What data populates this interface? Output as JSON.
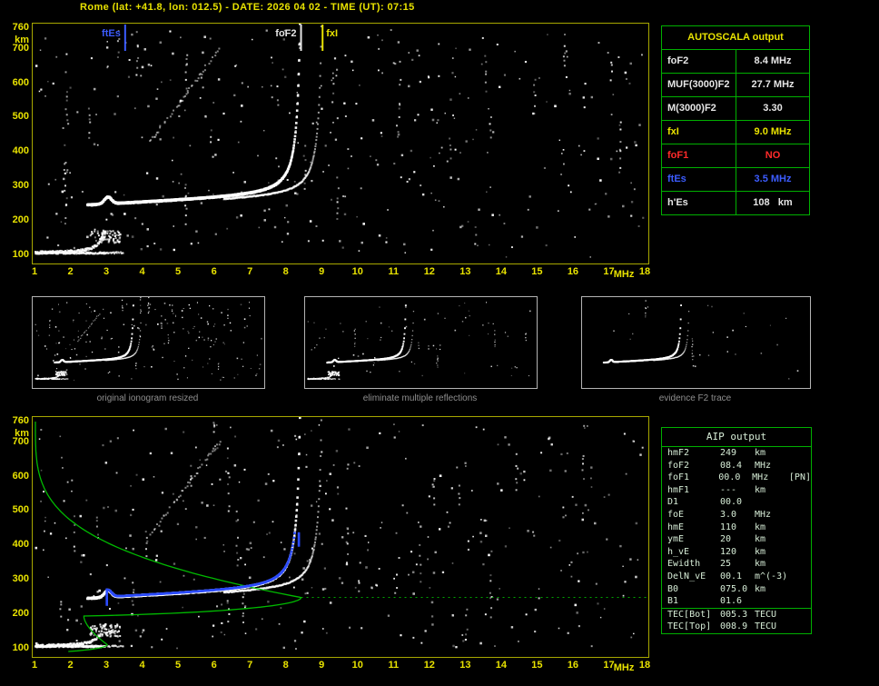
{
  "header": {
    "title": "Rome (lat: +41.8, lon: 012.5) - DATE: 2026 04 02 - TIME (UT): 07:15"
  },
  "colors": {
    "yellow": "#e8e200",
    "plot_border": "#a8a800",
    "table_green": "#00b000",
    "white": "#e6e6e6",
    "red": "#ff2a2a",
    "blue": "#3c5cff",
    "profile_green": "#00c400",
    "fit_blue": "#2b4bff",
    "caption_gray": "#8f8f8f",
    "aip_text": "#d6ecd6"
  },
  "autoscala": {
    "title": "AUTOSCALA output",
    "rows": [
      {
        "label": "foF2",
        "value": "8.4 MHz",
        "color": "#e6e6e6"
      },
      {
        "label": "MUF(3000)F2",
        "value": "27.7 MHz",
        "color": "#e6e6e6"
      },
      {
        "label": "M(3000)F2",
        "value": "3.30",
        "color": "#e6e6e6"
      },
      {
        "label": "fxI",
        "value": "9.0 MHz",
        "color": "#e8e200"
      },
      {
        "label": "foF1",
        "value": "NO",
        "color": "#ff2a2a"
      },
      {
        "label": "ftEs",
        "value": "3.5 MHz",
        "color": "#3c5cff"
      },
      {
        "label": "h'Es",
        "value": "108   km",
        "color": "#e6e6e6"
      }
    ]
  },
  "thumbnails": [
    {
      "caption": "original ionogram resized"
    },
    {
      "caption": "eliminate multiple reflections"
    },
    {
      "caption": "evidence F2 trace"
    }
  ],
  "aip": {
    "title": "AIP output",
    "rows": [
      {
        "label": "hmF2",
        "value": "249",
        "unit": "km",
        "extra": ""
      },
      {
        "label": "foF2",
        "value": "08.4",
        "unit": "MHz",
        "extra": ""
      },
      {
        "label": "foF1",
        "value": "00.0",
        "unit": "MHz",
        "extra": "[PN]"
      },
      {
        "label": "hmF1",
        "value": "---",
        "unit": "km",
        "extra": ""
      },
      {
        "label": "D1",
        "value": "00.0",
        "unit": "",
        "extra": ""
      },
      {
        "label": "foE",
        "value": "3.0",
        "unit": "MHz",
        "extra": ""
      },
      {
        "label": "hmE",
        "value": "110",
        "unit": "km",
        "extra": ""
      },
      {
        "label": "ymE",
        "value": "20",
        "unit": "km",
        "extra": ""
      },
      {
        "label": "h_vE",
        "value": "120",
        "unit": "km",
        "extra": ""
      },
      {
        "label": "Ewidth",
        "value": "25",
        "unit": "km",
        "extra": ""
      },
      {
        "label": "DelN_vE",
        "value": "00.1",
        "unit": "m^(-3)",
        "extra": ""
      },
      {
        "label": "B0",
        "value": "075.0",
        "unit": "km",
        "extra": ""
      },
      {
        "label": "B1",
        "value": "01.6",
        "unit": "",
        "extra": ""
      },
      {
        "label": "TEC[Bot]",
        "value": "005.3",
        "unit": "TECU",
        "extra": "",
        "sep": true
      },
      {
        "label": "TEC[Top]",
        "value": "008.9",
        "unit": "TECU",
        "extra": ""
      }
    ]
  },
  "chart_data": [
    {
      "type": "scatter",
      "name": "ionogram-top",
      "title": "Rome ionogram 2026-04-02 07:15 UT",
      "xlabel": "MHz",
      "ylabel": "km",
      "xlim": [
        1,
        18
      ],
      "ylim": [
        100,
        760
      ],
      "x_ticks": [
        1,
        2,
        3,
        4,
        5,
        6,
        7,
        8,
        9,
        10,
        11,
        12,
        13,
        14,
        15,
        16,
        17,
        18
      ],
      "y_ticks": [
        760,
        700,
        600,
        500,
        400,
        300,
        200,
        100
      ],
      "grid": false,
      "markers": [
        {
          "label": "ftEs",
          "freq": 3.5,
          "color": "#3c5cff"
        },
        {
          "label": "foF2",
          "freq": 8.4,
          "color": "#e6e6e6"
        },
        {
          "label": "fxI",
          "freq": 9.0,
          "color": "#e8e200"
        }
      ],
      "ionogram": {
        "foF2": 8.4,
        "fxI": 9.0,
        "foE": 3.0,
        "ftEs": 3.5,
        "hEs": 107,
        "min_virtual_height": 246,
        "second_hop": true,
        "seed": 42
      }
    },
    {
      "type": "scatter",
      "name": "ionogram-bottom-with-profile",
      "xlabel": "MHz",
      "ylabel": "km",
      "xlim": [
        1,
        18
      ],
      "ylim": [
        100,
        760
      ],
      "x_ticks": [
        1,
        2,
        3,
        4,
        5,
        6,
        7,
        8,
        9,
        10,
        11,
        12,
        13,
        14,
        15,
        16,
        17,
        18
      ],
      "y_ticks": [
        760,
        700,
        600,
        500,
        400,
        300,
        200,
        100
      ],
      "grid": false,
      "markers": [],
      "ionogram": {
        "foF2": 8.4,
        "fxI": 9.0,
        "foE": 3.0,
        "ftEs": 3.5,
        "hEs": 107,
        "min_virtual_height": 246,
        "second_hop": true,
        "seed": 77
      },
      "fit": {
        "color": "#2b4bff",
        "f_start": 3.02,
        "f_end": 8.39,
        "h_cap": 438,
        "cusp_freq": 2.99
      },
      "profile": {
        "color": "#00c400",
        "foF2": 8.4,
        "hmF2": 249,
        "foE": 3.0,
        "hmE": 110,
        "top_height": 760,
        "dotted_line_height": 249,
        "key_points": [
          [
            1.0,
            760
          ],
          [
            1.7,
            500
          ],
          [
            3.2,
            400
          ],
          [
            6.1,
            300
          ],
          [
            8.4,
            249
          ],
          [
            4.1,
            205
          ],
          [
            2.4,
            185
          ],
          [
            3.0,
            110
          ],
          [
            1.9,
            92
          ]
        ]
      }
    }
  ]
}
